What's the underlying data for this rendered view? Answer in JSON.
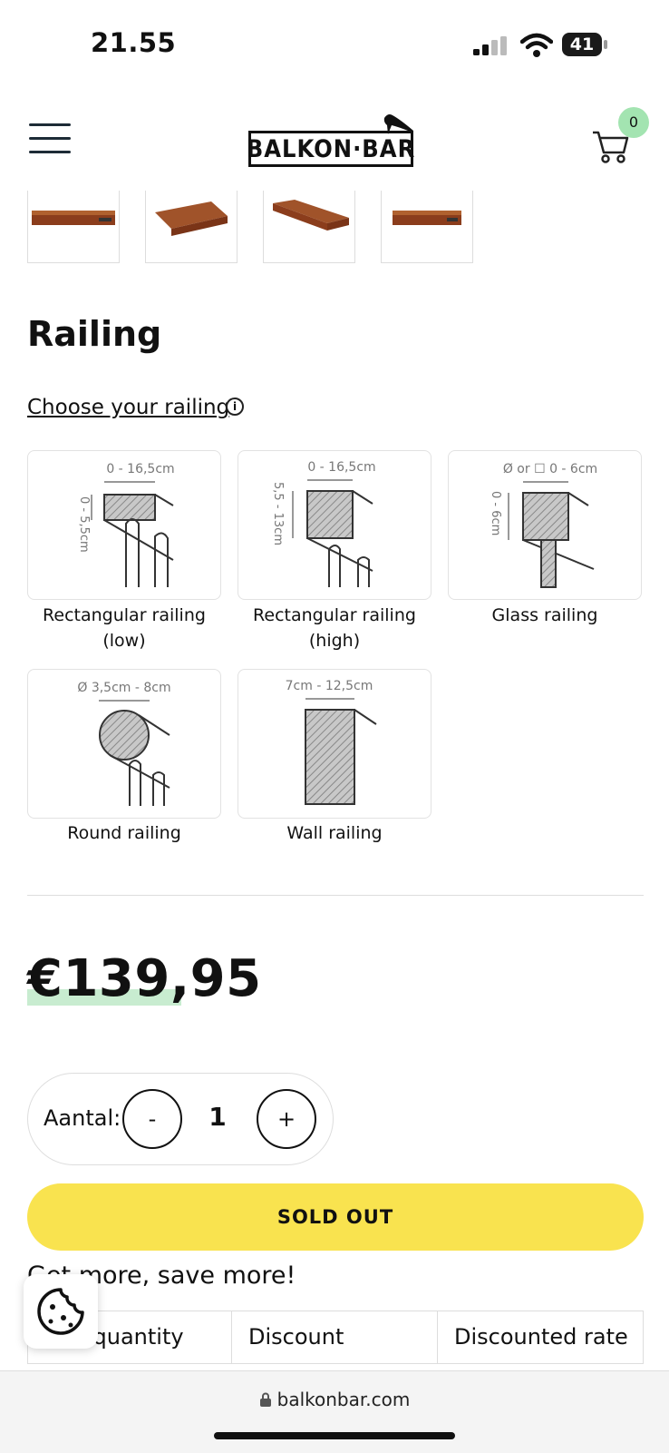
{
  "status_bar": {
    "time": "21.55",
    "battery": "41"
  },
  "header": {
    "logo_text": "BALKON·BAR",
    "cart_count": "0"
  },
  "thumbnails": [
    "thumb-1",
    "thumb-2",
    "thumb-3",
    "thumb-4"
  ],
  "railing": {
    "title": "Railing",
    "choose_label": "Choose your railing",
    "info_icon": "i",
    "options": [
      {
        "label": "Rectangular railing (low)",
        "dim_top": "0 - 16,5cm",
        "dim_side": "0 - 5,5cm"
      },
      {
        "label": "Rectangular railing (high)",
        "dim_top": "0 - 16,5cm",
        "dim_side": "5,5 - 13cm"
      },
      {
        "label": "Glass railing",
        "dim_top": "Ø or ☐ 0 - 6cm",
        "dim_side": "0 - 6cm"
      },
      {
        "label": "Round railing",
        "dim_top": "Ø 3,5cm - 8cm",
        "dim_side": ""
      },
      {
        "label": "Wall railing",
        "dim_top": "7cm - 12,5cm",
        "dim_side": ""
      }
    ]
  },
  "price": "€139,95",
  "quantity": {
    "label": "Aantal:",
    "minus": "-",
    "value": "1",
    "plus": "+"
  },
  "sold_out_label": "SOLD OUT",
  "promo": {
    "text": "Get more, save more!",
    "columns": [
      "Buy quantity",
      "Discount",
      "Discounted rate"
    ]
  },
  "browser": {
    "url": "balkonbar.com"
  },
  "colors": {
    "accent_yellow": "#f9e34f",
    "badge_green": "#a3e4b1",
    "price_highlight": "#c8ecd0"
  }
}
